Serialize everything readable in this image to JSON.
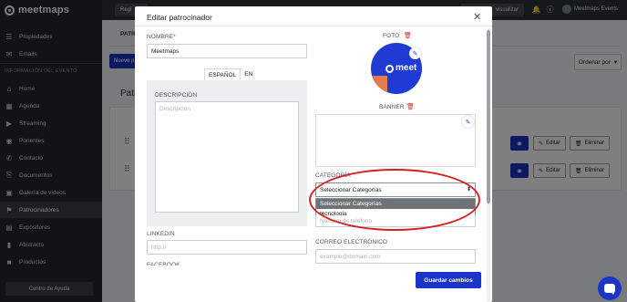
{
  "brand": {
    "name": "meetmaps"
  },
  "sidebar": {
    "top_items": [
      {
        "label": "Propiedades",
        "icon": "list-icon"
      },
      {
        "label": "Emails",
        "icon": "mail-icon"
      }
    ],
    "section_title": "INFORMACIÓN DEL EVENTO",
    "items": [
      {
        "label": "Home",
        "icon": "home-icon"
      },
      {
        "label": "Agenda",
        "icon": "calendar-icon"
      },
      {
        "label": "Streaming",
        "icon": "video-icon"
      },
      {
        "label": "Ponentes",
        "icon": "speaker-icon"
      },
      {
        "label": "Contacto",
        "icon": "phone-icon"
      },
      {
        "label": "Documentos",
        "icon": "document-icon"
      },
      {
        "label": "Galería de videos",
        "icon": "film-icon"
      },
      {
        "label": "Patrocinadores",
        "icon": "flag-icon",
        "active": true
      },
      {
        "label": "Expositores",
        "icon": "store-icon"
      },
      {
        "label": "Abstracts",
        "icon": "bookmark-icon"
      },
      {
        "label": "Productos",
        "icon": "box-icon"
      }
    ],
    "help_button": "Centro de Ayuda"
  },
  "topbar": {
    "left_pill": "Regi",
    "preview_pill": "visualizar",
    "user_name": "Meetmaps Events"
  },
  "main": {
    "tab": "PATR",
    "new_button": "Nuevo p",
    "order_button": "Ordenar por",
    "panel_title": "Patro",
    "rows": [
      {
        "edit": "Editar",
        "delete": "Eliminar"
      },
      {
        "edit": "Editar",
        "delete": "Eliminar"
      }
    ]
  },
  "modal": {
    "title": "Editar patrocinador",
    "name_label": "NOMBRE*",
    "name_value": "Meetmaps",
    "lang_tabs": [
      "ESPAÑOL",
      "EN"
    ],
    "description_label": "DESCRIPCIÓN",
    "description_placeholder": "Descripción",
    "linkedin_label": "LINKEDIN",
    "linkedin_placeholder": "http://",
    "cut_label": "FACEBOOK",
    "photo_label": "FOTO",
    "photo_logo_text": "meet",
    "banner_label": "BANNER",
    "category_label": "CATEGORÍA",
    "category_selected": "Seleccionar Categorías",
    "category_options": [
      "Seleccionar Categorías",
      "tecnologia"
    ],
    "phone_placeholder": "Número de teléfono",
    "email_label": "CORREO ELECTRÓNICO",
    "email_placeholder": "example@domain.com",
    "save_button": "Guardar cambios"
  },
  "colors": {
    "primary": "#1a35c7",
    "sidebar_bg": "#23282e",
    "danger": "#d22a2a",
    "annotation": "#d41f25"
  }
}
